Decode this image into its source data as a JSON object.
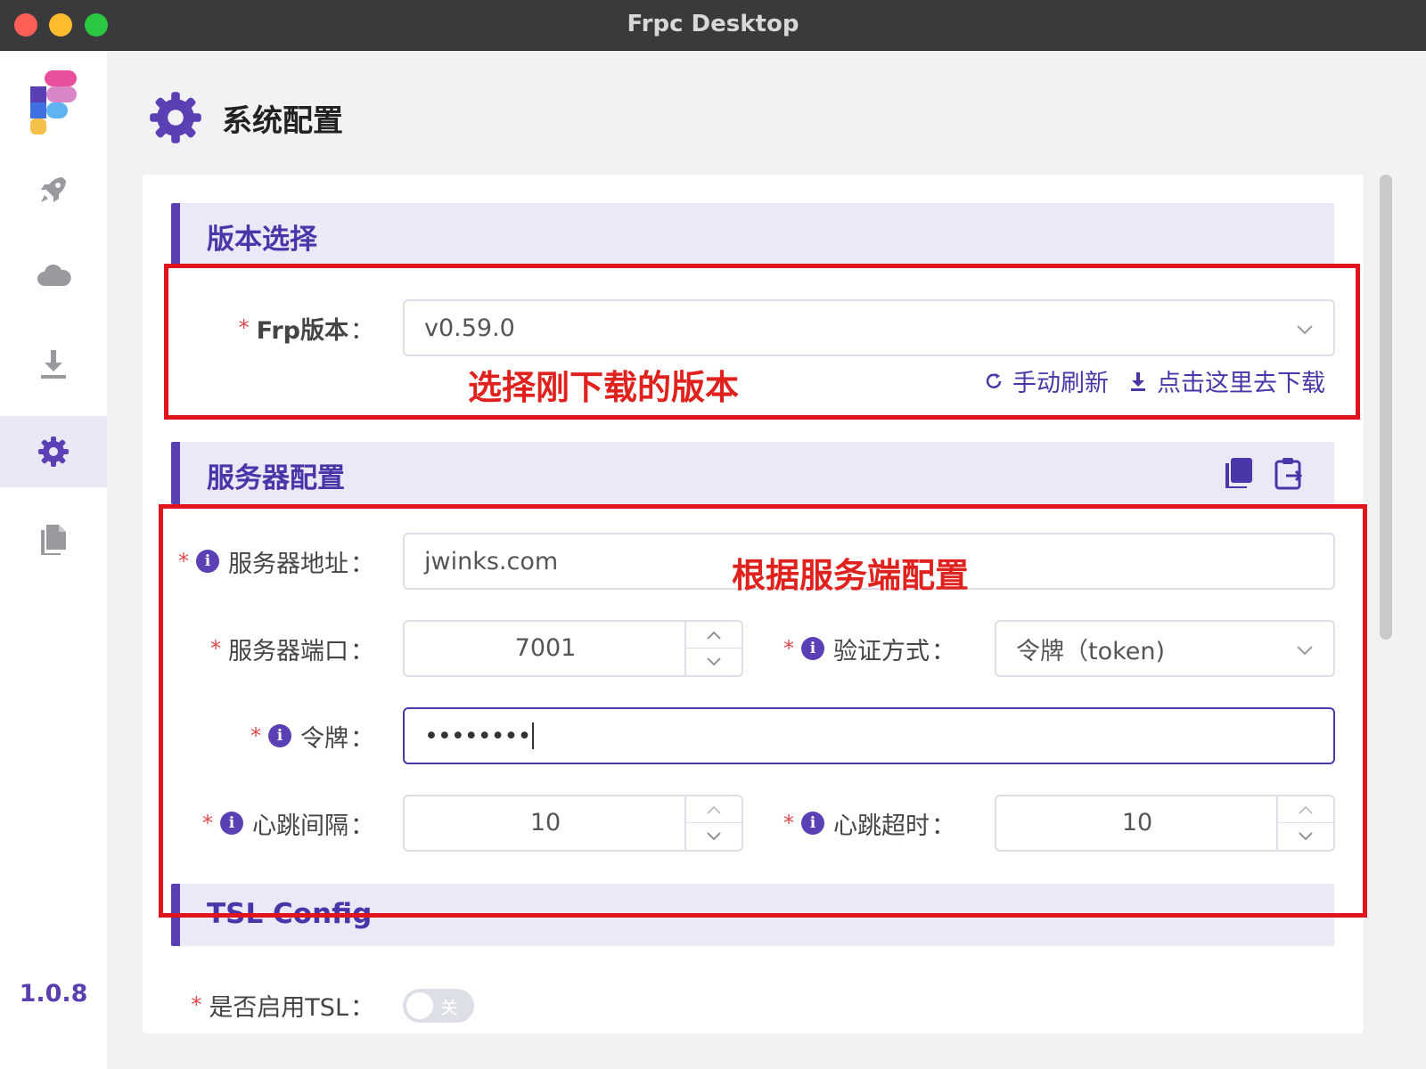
{
  "window": {
    "title": "Frpc Desktop"
  },
  "sidebar": {
    "items": [
      {
        "icon": "rocket-icon"
      },
      {
        "icon": "cloud-icon"
      },
      {
        "icon": "download-icon"
      },
      {
        "icon": "gear-icon",
        "active": true
      },
      {
        "icon": "document-icon"
      }
    ],
    "version": "1.0.8"
  },
  "page": {
    "title": "系统配置"
  },
  "version_section": {
    "title": "版本选择",
    "frp_version_label": "Frp版本",
    "frp_version_value": "v0.59.0",
    "refresh_label": "手动刷新",
    "download_label": "点击这里去下载",
    "annotation": "选择刚下载的版本"
  },
  "server_section": {
    "title": "服务器配置",
    "address_label": "服务器地址",
    "address_value": "jwinks.com",
    "annotation": "根据服务端配置",
    "port_label": "服务器端口",
    "port_value": "7001",
    "auth_label": "验证方式",
    "auth_value": "令牌（token)",
    "token_label": "令牌",
    "token_value": "••••••••",
    "heartbeat_interval_label": "心跳间隔",
    "heartbeat_interval_value": "10",
    "heartbeat_timeout_label": "心跳超时",
    "heartbeat_timeout_value": "10"
  },
  "tls_section": {
    "title": "TSL Config",
    "enable_label": "是否启用TSL",
    "toggle_off_text": "关"
  },
  "common": {
    "colon": "：",
    "required": "*",
    "info": "i"
  },
  "colors": {
    "accent": "#5b3fb5",
    "annotation": "#e0141d"
  }
}
